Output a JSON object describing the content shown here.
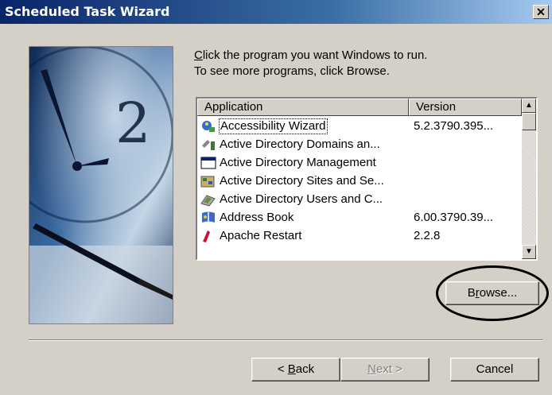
{
  "window": {
    "title": "Scheduled Task Wizard",
    "close_label": "✕"
  },
  "instructions": {
    "line1_prefix": "C",
    "line1_rest": "lick the program you want Windows to run.",
    "line2": "To see more programs, click Browse."
  },
  "list": {
    "columns": [
      "Application",
      "Version"
    ],
    "rows": [
      {
        "name": "Accessibility Wizard",
        "version": "5.2.3790.395...",
        "icon": "accessibility-wizard-icon"
      },
      {
        "name": "Active Directory Domains an...",
        "version": "",
        "icon": "ad-domains-icon"
      },
      {
        "name": "Active Directory Management",
        "version": "",
        "icon": "ad-management-icon"
      },
      {
        "name": "Active Directory Sites and Se...",
        "version": "",
        "icon": "ad-sites-icon"
      },
      {
        "name": "Active Directory Users and C...",
        "version": "",
        "icon": "ad-users-icon"
      },
      {
        "name": "Address Book",
        "version": "6.00.3790.39...",
        "icon": "address-book-icon"
      },
      {
        "name": "Apache Restart",
        "version": "2.2.8",
        "icon": "apache-restart-icon"
      }
    ]
  },
  "buttons": {
    "browse_pre": "B",
    "browse_u": "r",
    "browse_post": "owse...",
    "back_pre": "< ",
    "back_u": "B",
    "back_post": "ack",
    "next_u": "N",
    "next_post": "ext >",
    "cancel": "Cancel"
  },
  "colors": {
    "titlebar_start": "#0a246a",
    "titlebar_end": "#a6caf0",
    "annotation": "#000000"
  }
}
